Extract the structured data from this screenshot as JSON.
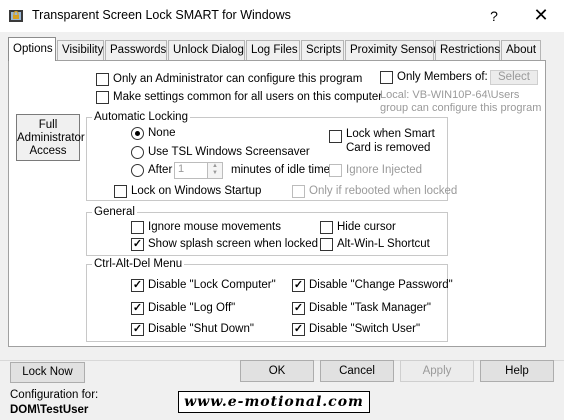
{
  "window": {
    "title": "Transparent Screen Lock SMART for Windows",
    "help_glyph": "?",
    "close_glyph": "✕"
  },
  "tabs": [
    {
      "label": "Options",
      "active": true
    },
    {
      "label": "Visibility"
    },
    {
      "label": "Passwords"
    },
    {
      "label": "Unlock Dialog"
    },
    {
      "label": "Log Files"
    },
    {
      "label": "Scripts"
    },
    {
      "label": "Proximity Sensor"
    },
    {
      "label": "Restrictions"
    },
    {
      "label": "About"
    }
  ],
  "options": {
    "admin_only_label": "Only an Administrator can configure this program",
    "admin_only_checked": false,
    "common_settings_label": "Make settings common for all users on this computer",
    "common_settings_checked": false,
    "members_of_label": "Only Members of:",
    "members_of_checked": false,
    "select_button": "Select",
    "group_info": "Local: VB-WIN10P-64\\Users group can configure this program",
    "full_admin_button": "Full Administrator Access"
  },
  "automatic_locking": {
    "title": "Automatic Locking",
    "none_label": "None",
    "tsl_saver_label": "Use TSL Windows Screensaver",
    "after_label": "After",
    "after_value": "1",
    "minutes_label": "minutes of idle time",
    "selected": "none",
    "lock_smart_label": "Lock when Smart Card is removed",
    "lock_smart_checked": false,
    "ignore_injected_label": "Ignore Injected",
    "lock_startup_label": "Lock on Windows Startup",
    "lock_startup_checked": false,
    "only_rebooted_label": "Only if rebooted when locked"
  },
  "general": {
    "title": "General",
    "ignore_mouse_label": "Ignore mouse movements",
    "ignore_mouse_checked": false,
    "splash_label": "Show splash screen when locked",
    "splash_checked": true,
    "hide_cursor_label": "Hide cursor",
    "hide_cursor_checked": false,
    "altwin_label": "Alt-Win-L Shortcut",
    "altwin_checked": false
  },
  "ctrl_alt_del": {
    "title": "Ctrl-Alt-Del Menu",
    "lock_computer_label": "Disable \"Lock Computer\"",
    "log_off_label": "Disable \"Log Off\"",
    "shut_down_label": "Disable \"Shut Down\"",
    "change_password_label": "Disable \"Change Password\"",
    "task_manager_label": "Disable \"Task Manager\"",
    "switch_user_label": "Disable \"Switch User\"",
    "check_glyph": "✓"
  },
  "footer": {
    "lock_now": "Lock Now",
    "ok": "OK",
    "cancel": "Cancel",
    "apply": "Apply",
    "help": "Help",
    "config_for_label": "Configuration for:",
    "config_user": "DOM\\TestUser",
    "brand": "www.e-motional.com"
  }
}
